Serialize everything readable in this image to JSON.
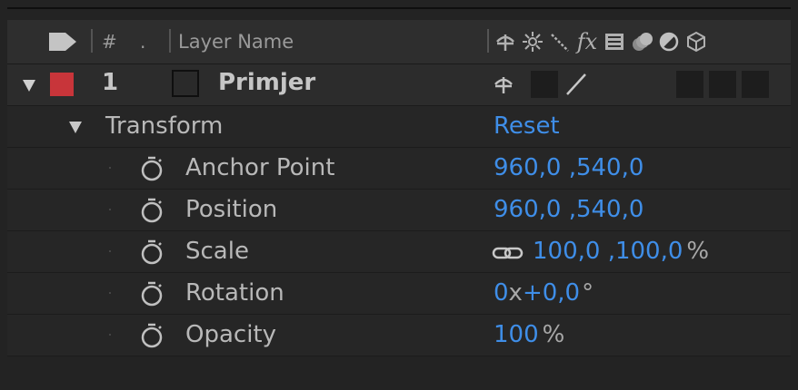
{
  "header": {
    "number_label": "#",
    "dot_label": ".",
    "layer_name_label": "Layer Name",
    "switch_icons": [
      "shy-icon",
      "collapse-icon",
      "quality-icon",
      "fx-icon",
      "frame-blend-icon",
      "motion-blur-icon",
      "adjustment-icon",
      "3d-layer-icon"
    ]
  },
  "layer": {
    "number": "1",
    "name": "Primjer",
    "label_color": "#c8353a"
  },
  "transform": {
    "label": "Transform",
    "reset_label": "Reset",
    "properties": [
      {
        "name": "Anchor Point",
        "value": "960,0 ,540,0",
        "unit": ""
      },
      {
        "name": "Position",
        "value": "960,0 ,540,0",
        "unit": ""
      },
      {
        "name": "Scale",
        "value": "100,0 ,100,0",
        "unit": "%"
      },
      {
        "name": "Rotation",
        "value": "0",
        "x": "x",
        "rest": "+0,0",
        "unit": "°"
      },
      {
        "name": "Opacity",
        "value": "100",
        "unit": "%"
      }
    ]
  },
  "colors": {
    "value_blue": "#3f8ee8",
    "panel_bg": "#232323"
  }
}
